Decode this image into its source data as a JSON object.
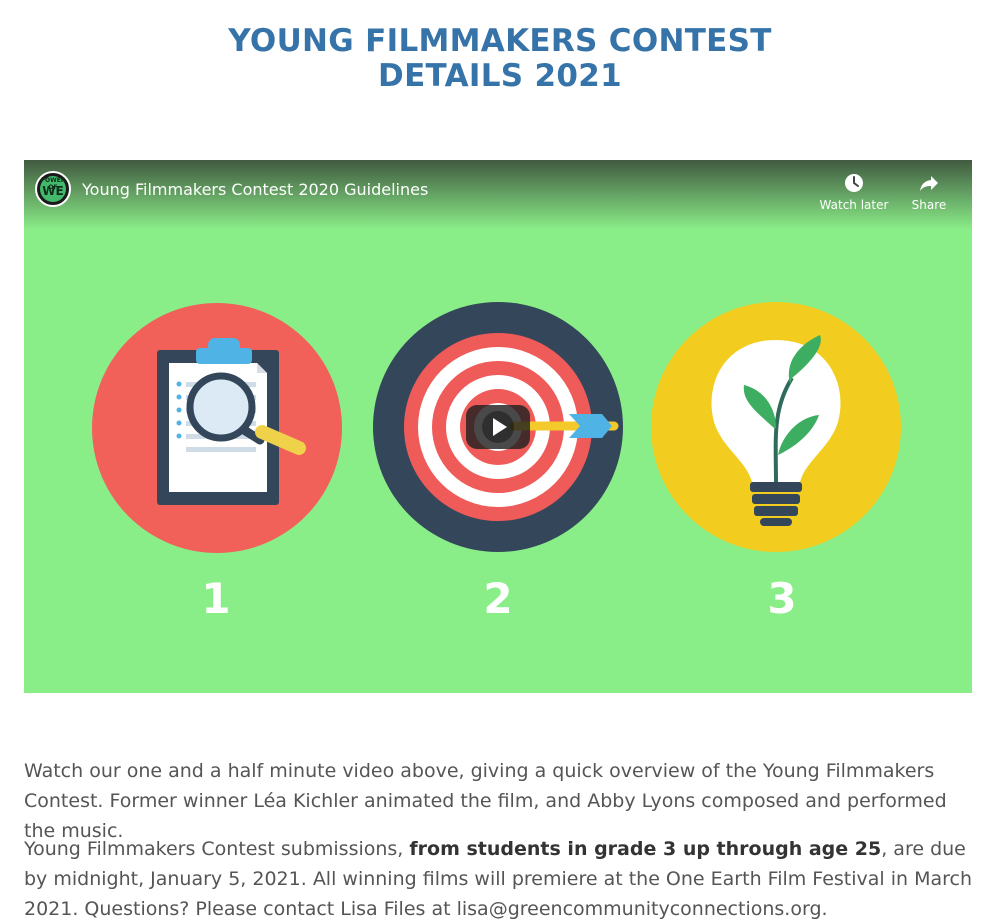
{
  "header": {
    "title_line1": "YOUNG FILMMAKERS CONTEST",
    "title_line2": "DETAILS 2021"
  },
  "video": {
    "title": "Young Filmmakers Contest 2020 Guidelines",
    "channel_logo_text_top": "POWER OF",
    "channel_logo_text_main": "WE",
    "watch_later_label": "Watch later",
    "share_label": "Share",
    "background_color": "#8aee88",
    "steps": [
      "1",
      "2",
      "3"
    ],
    "step_icons": [
      "clipboard-magnifier-icon",
      "target-dart-icon",
      "lightbulb-plant-icon"
    ]
  },
  "content": {
    "paragraph1": "Watch our one and a half minute video above, giving a quick overview of the Young Filmmakers Contest. Former winner Léa Kichler animated the film, and Abby Lyons composed and performed the music.",
    "paragraph2_start": "Young Filmmakers Contest submissions, ",
    "paragraph2_bold": "from students in grade 3 up through age 25",
    "paragraph2_middle": ", are due by midnight, January 5, 2021. All winning films will premiere at the One Earth Film Festival in March 2021. Questions? Please contact Lisa Files at ",
    "contact_email": "lisa@greencommunityconnections.org",
    "paragraph2_end": "."
  },
  "colors": {
    "title": "#3573a8",
    "text": "#555555"
  }
}
